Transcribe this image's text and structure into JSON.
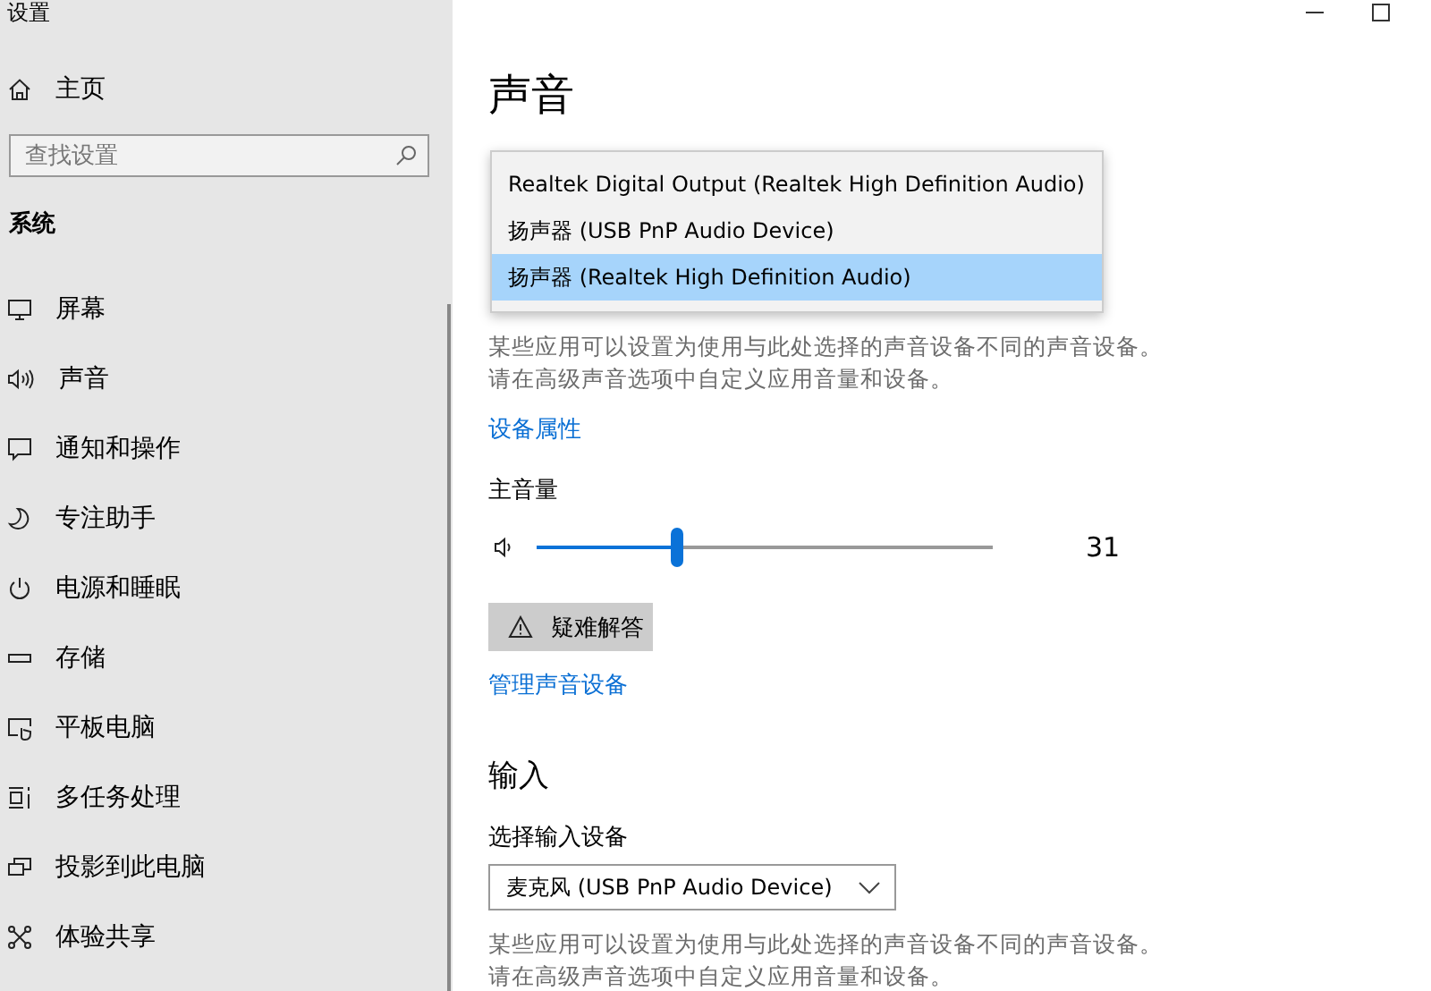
{
  "window": {
    "title": "设置"
  },
  "sidebar": {
    "home": "主页",
    "search": {
      "placeholder": "查找设置"
    },
    "section": "系统",
    "items": [
      {
        "label": "屏幕"
      },
      {
        "label": "声音"
      },
      {
        "label": "通知和操作"
      },
      {
        "label": "专注助手"
      },
      {
        "label": "电源和睡眠"
      },
      {
        "label": "存储"
      },
      {
        "label": "平板电脑"
      },
      {
        "label": "多任务处理"
      },
      {
        "label": "投影到此电脑"
      },
      {
        "label": "体验共享"
      }
    ]
  },
  "page": {
    "title": "声音",
    "output_dropdown": {
      "options": [
        {
          "label": "Realtek Digital Output (Realtek High Definition Audio)",
          "selected": false
        },
        {
          "label": "扬声器 (USB PnP Audio Device)",
          "selected": false
        },
        {
          "label": "扬声器 (Realtek High Definition Audio)",
          "selected": true
        }
      ]
    },
    "output_note": [
      "某些应用可以设置为使用与此处选择的声音设备不同的声音设备。",
      "请在高级声音选项中自定义应用音量和设备。"
    ],
    "device_properties_link": "设备属性",
    "volume": {
      "label": "主音量",
      "level": 0.31,
      "reading": "31"
    },
    "troubleshoot_button": "疑难解答",
    "manage_link": "管理声音设备",
    "input": {
      "heading": "输入",
      "label": "选择输入设备",
      "value": "麦克风 (USB PnP Audio Device)",
      "note": [
        "某些应用可以设置为使用与此处选择的声音设备不同的声音设备。",
        "请在高级声音选项中自定义应用音量和设备。"
      ]
    }
  }
}
